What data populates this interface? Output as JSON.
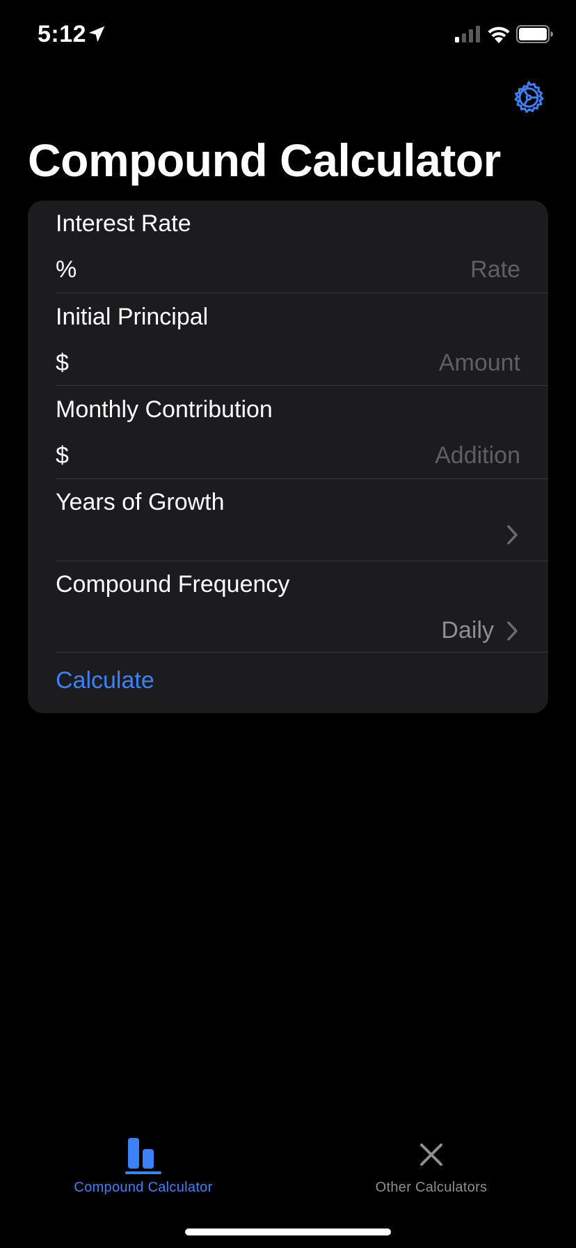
{
  "status_bar": {
    "time": "5:12"
  },
  "header": {
    "title": "Compound Calculator"
  },
  "form": {
    "interest_rate": {
      "label": "Interest Rate",
      "prefix": "%",
      "placeholder": "Rate"
    },
    "initial_principal": {
      "label": "Initial Principal",
      "prefix": "$",
      "placeholder": "Amount"
    },
    "monthly_contribution": {
      "label": "Monthly Contribution",
      "prefix": "$",
      "placeholder": "Addition"
    },
    "years_of_growth": {
      "label": "Years of Growth"
    },
    "compound_frequency": {
      "label": "Compound Frequency",
      "value": "Daily"
    },
    "calculate_label": "Calculate"
  },
  "tabbar": {
    "tabs": [
      {
        "label": "Compound Calculator",
        "icon": "bar-chart-icon",
        "active": true
      },
      {
        "label": "Other Calculators",
        "icon": "close-x-icon",
        "active": false
      }
    ]
  },
  "colors": {
    "accent": "#3b82f6",
    "background": "#000000",
    "card": "#1c1c1e",
    "separator": "#38383a",
    "placeholder": "#5f5f64",
    "secondary_text": "#8e8e93"
  }
}
